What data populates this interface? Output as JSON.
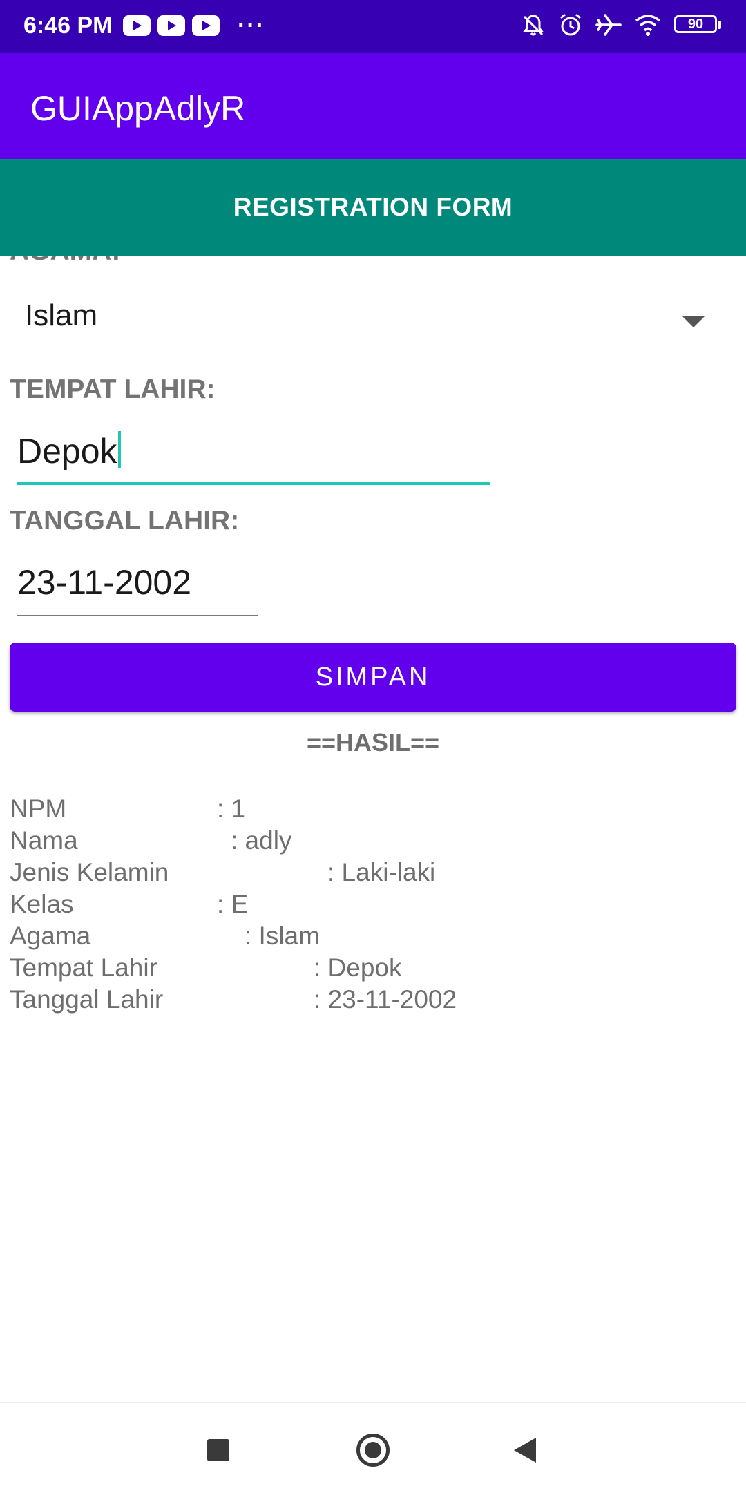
{
  "status_bar": {
    "time": "6:46 PM",
    "more": "···",
    "battery": "90",
    "notification_icons": [
      "youtube-icon",
      "youtube-icon",
      "youtube-icon"
    ],
    "system_icons": [
      "muted-bell-icon",
      "alarm-icon",
      "airplane-icon",
      "wifi-icon",
      "battery-icon"
    ]
  },
  "app_bar": {
    "title": "GUIAppAdlyR"
  },
  "header": {
    "title": "REGISTRATION FORM"
  },
  "form": {
    "agama_label": "AGAMA:",
    "agama_value": "Islam",
    "tempat_label": "TEMPAT LAHIR:",
    "tempat_value": "Depok",
    "tanggal_label": "TANGGAL LAHIR:",
    "tanggal_value": "23-11-2002",
    "save_label": "SIMPAN"
  },
  "hasil": {
    "title": "==HASIL==",
    "rows": [
      {
        "label": "NPM",
        "value": ": 1"
      },
      {
        "label": "Nama",
        "value": ": adly"
      },
      {
        "label": "Jenis Kelamin",
        "value": ": Laki-laki"
      },
      {
        "label": "Kelas",
        "value": ": E"
      },
      {
        "label": "Agama",
        "value": ": Islam"
      },
      {
        "label": "Tempat Lahir",
        "value": ": Depok"
      },
      {
        "label": "Tanggal Lahir",
        "value": ": 23-11-2002"
      }
    ]
  },
  "nav_bar": {
    "icons": [
      "recents-icon",
      "home-icon",
      "back-icon"
    ]
  },
  "colors": {
    "status_bar": "#3700b3",
    "primary": "#6200ee",
    "header": "#00897b",
    "accent": "#1ec8b8",
    "label_text": "#737373"
  }
}
